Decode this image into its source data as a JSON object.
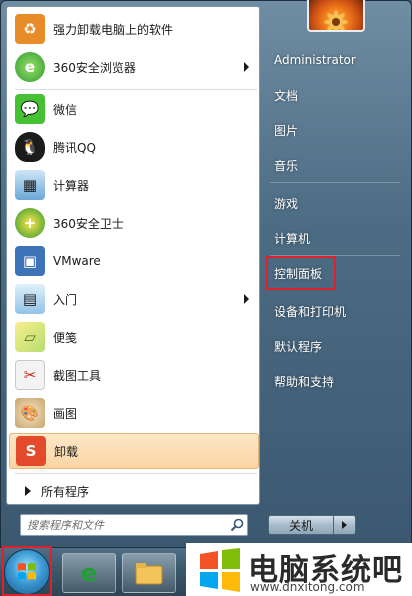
{
  "programs": [
    {
      "label": "强力卸载电脑上的软件",
      "icon": "uninstaller-icon",
      "has_arrow": false
    },
    {
      "label": "360安全浏览器",
      "icon": "360-browser-icon",
      "has_arrow": true
    },
    {
      "label": "微信",
      "icon": "wechat-icon",
      "has_arrow": false
    },
    {
      "label": "腾讯QQ",
      "icon": "qq-penguin-icon",
      "has_arrow": false
    },
    {
      "label": "计算器",
      "icon": "calculator-icon",
      "has_arrow": false
    },
    {
      "label": "360安全卫士",
      "icon": "360-security-icon",
      "has_arrow": false
    },
    {
      "label": "VMware",
      "icon": "vmware-icon",
      "has_arrow": false
    },
    {
      "label": "入门",
      "icon": "getting-started-icon",
      "has_arrow": true
    },
    {
      "label": "便笺",
      "icon": "sticky-notes-icon",
      "has_arrow": false
    },
    {
      "label": "截图工具",
      "icon": "snipping-tool-icon",
      "has_arrow": false
    },
    {
      "label": "画图",
      "icon": "paint-icon",
      "has_arrow": false
    },
    {
      "label": "卸载",
      "icon": "uninstall-icon",
      "has_arrow": false
    }
  ],
  "all_programs": "所有程序",
  "search": {
    "placeholder": "搜索程序和文件"
  },
  "right_menu": [
    "Administrator",
    "文档",
    "图片",
    "音乐",
    "游戏",
    "计算机",
    "控制面板",
    "设备和打印机",
    "默认程序",
    "帮助和支持"
  ],
  "shutdown_label": "关机",
  "watermark": {
    "title": "电脑系统吧",
    "url": "www.dnxitong.com"
  },
  "colors": {
    "highlight": "#fbd5a4",
    "red_box": "#e0202a",
    "frame": "#4d6d84"
  }
}
